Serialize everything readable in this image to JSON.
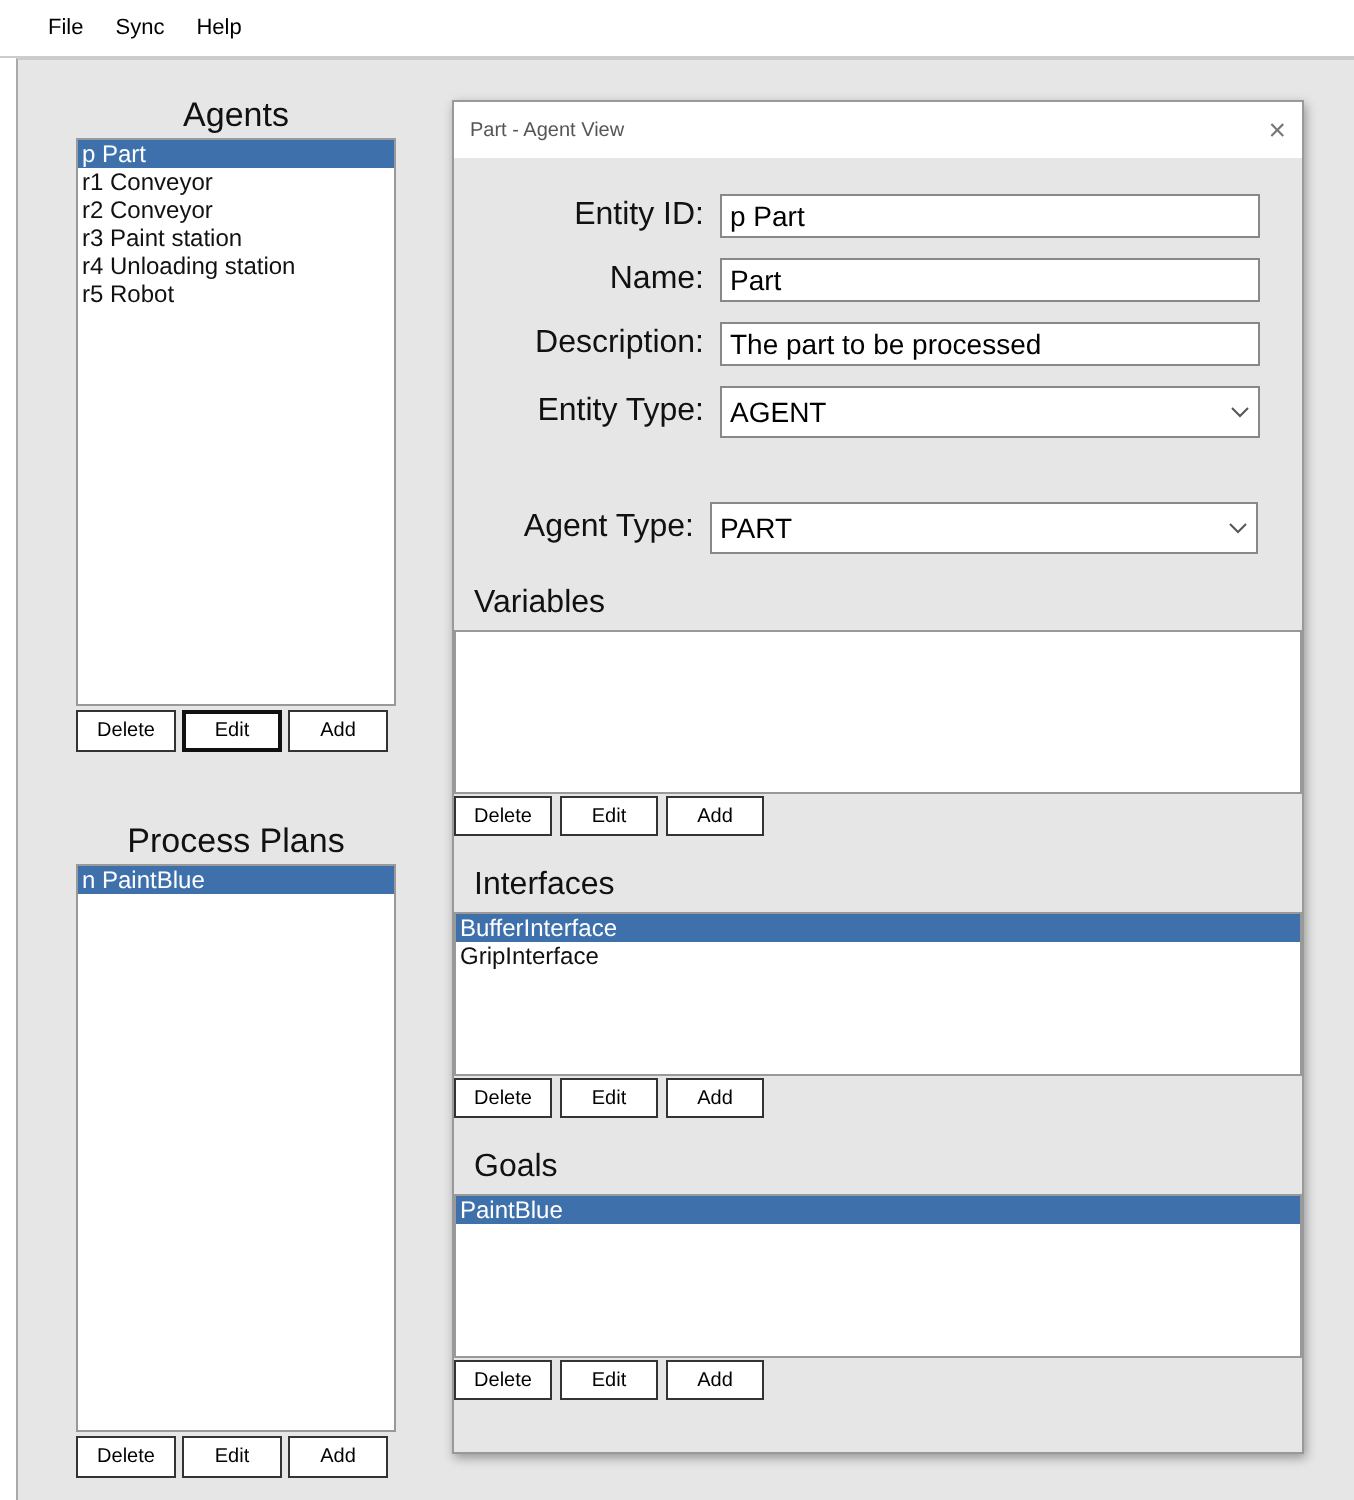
{
  "menu": [
    {
      "label": "File"
    },
    {
      "label": "Sync"
    },
    {
      "label": "Help"
    }
  ],
  "main": {
    "panels": [
      {
        "title": "Agents",
        "items": [
          {
            "label": "p Part",
            "selected": true
          },
          {
            "label": "r1 Conveyor",
            "selected": false
          },
          {
            "label": "r2 Conveyor",
            "selected": false
          },
          {
            "label": "r3 Paint station",
            "selected": false
          },
          {
            "label": "r4 Unloading station",
            "selected": false
          },
          {
            "label": "r5 Robot",
            "selected": false
          }
        ],
        "buttons": [
          {
            "label": "Delete",
            "focused": false
          },
          {
            "label": "Edit",
            "focused": true
          },
          {
            "label": "Add",
            "focused": false
          }
        ]
      },
      {
        "title": "Process Plans",
        "items": [
          {
            "label": "n PaintBlue",
            "selected": true
          }
        ],
        "buttons": [
          {
            "label": "Delete",
            "focused": false
          },
          {
            "label": "Edit",
            "focused": false
          },
          {
            "label": "Add",
            "focused": false
          }
        ]
      }
    ]
  },
  "dialog": {
    "title": "Part - Agent View",
    "close": "×",
    "fields": [
      {
        "label": "Entity ID:",
        "value": "p Part",
        "kind": "text"
      },
      {
        "label": "Name:",
        "value": "Part",
        "kind": "text"
      },
      {
        "label": "Description:",
        "value": "The part to be processed",
        "kind": "text"
      },
      {
        "label": "Entity Type:",
        "value": "AGENT",
        "kind": "select"
      }
    ],
    "agent_type": {
      "label": "Agent Type:",
      "value": "PART"
    },
    "sections": [
      {
        "title": "Variables",
        "buttons": [
          {
            "label": "Delete",
            "focused": false
          },
          {
            "label": "Edit",
            "focused": false
          },
          {
            "label": "Add",
            "focused": false
          }
        ]
      },
      {
        "title": "Interfaces",
        "items": [
          {
            "label": "BufferInterface",
            "selected": true
          },
          {
            "label": "GripInterface",
            "selected": false
          }
        ],
        "buttons": [
          {
            "label": "Delete",
            "focused": false
          },
          {
            "label": "Edit",
            "focused": false
          },
          {
            "label": "Add",
            "focused": false
          }
        ]
      },
      {
        "title": "Goals",
        "items": [
          {
            "label": "PaintBlue",
            "selected": true
          }
        ],
        "buttons": [
          {
            "label": "Delete",
            "focused": false
          },
          {
            "label": "Edit",
            "focused": false
          },
          {
            "label": "Add",
            "focused": false
          }
        ]
      }
    ]
  }
}
